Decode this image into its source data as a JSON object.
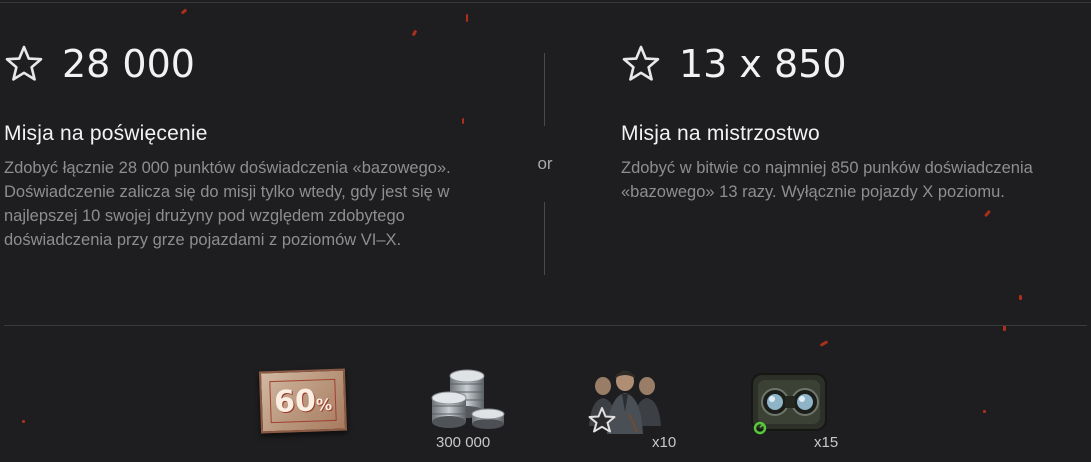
{
  "missions": [
    {
      "icon": "star-outline-icon",
      "amount": "28 000",
      "title": "Misja na poświęcenie",
      "description": "Zdobyć łącznie 28 000 punktów doświadczenia «bazowego». Doświadczenie zalicza się do misji tylko wtedy, gdy jest się w najlepszej 10 swojej drużyny pod względem zdobytego doświadczenia przy grze pojazdami z poziomów VI–X."
    },
    {
      "icon": "star-outline-icon",
      "amount": "13 x 850",
      "title": "Misja na mistrzostwo",
      "description": "Zdobyć w bitwie co najmniej 850 punków doświadczenia «bazowego» 13 razy. Wyłącznie pojazdy X poziomu."
    }
  ],
  "separator_label": "or",
  "rewards": [
    {
      "icon": "discount-card-icon",
      "value": "60",
      "unit": "%",
      "caption": ""
    },
    {
      "icon": "silver-coins-icon",
      "caption": "300 000"
    },
    {
      "icon": "crew-members-icon",
      "caption": "x10"
    },
    {
      "icon": "binocular-equipment-icon",
      "caption": "x15"
    }
  ],
  "colors": {
    "background": "#1e1e20",
    "text_primary": "#f2f2f2",
    "text_secondary": "#8e8e8e",
    "ember": "#c4321a"
  }
}
